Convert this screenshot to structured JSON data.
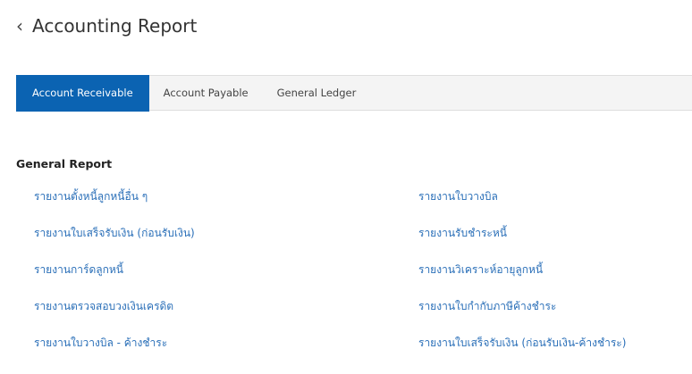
{
  "header": {
    "back_icon": "‹",
    "title": "Accounting Report"
  },
  "tabs": [
    {
      "label": "Account Receivable",
      "active": true
    },
    {
      "label": "Account Payable",
      "active": false
    },
    {
      "label": "General Ledger",
      "active": false
    }
  ],
  "colors": {
    "accent": "#0b63b2",
    "link": "#2a6fb8"
  },
  "section": {
    "title": "General Report"
  },
  "reports": [
    {
      "left": "รายงานตั้งหนี้ลูกหนี้อื่น ๆ",
      "right": "รายงานใบวางบิล"
    },
    {
      "left": "รายงานใบเสร็จรับเงิน (ก่อนรับเงิน)",
      "right": "รายงานรับชำระหนี้"
    },
    {
      "left": "รายงานการ์ดลูกหนี้",
      "right": "รายงานวิเคราะห์อายุลูกหนี้"
    },
    {
      "left": "รายงานตรวจสอบวงเงินเครดิต",
      "right": "รายงานใบกำกับภาษีค้างชำระ"
    },
    {
      "left": "รายงานใบวางบิล - ค้างชำระ",
      "right": "รายงานใบเสร็จรับเงิน (ก่อนรับเงิน-ค้างชำระ)"
    }
  ]
}
